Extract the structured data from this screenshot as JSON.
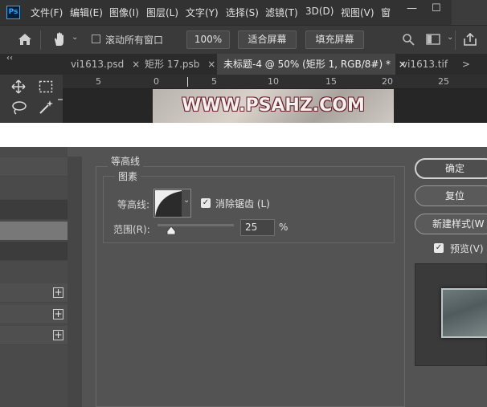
{
  "app": {
    "logo_text": "Ps"
  },
  "menubar": {
    "items": [
      "文件(F)",
      "编辑(E)",
      "图像(I)",
      "图层(L)",
      "文字(Y)",
      "选择(S)",
      "滤镜(T)",
      "3D(D)",
      "视图(V)",
      "窗"
    ],
    "minimize": "—",
    "maximize": "☐"
  },
  "options_bar": {
    "scroll_all_label": "滚动所有窗口",
    "zoom_value": "100%",
    "fit_screen_label": "适合屏幕",
    "fill_screen_label": "填充屏幕"
  },
  "tabs": [
    {
      "label": "vi1613.psd",
      "close": "×"
    },
    {
      "label": "矩形 17.psb",
      "close": "×"
    },
    {
      "label": "未标题-4 @ 50% (矩形 1, RGB/8#) *",
      "close": "×"
    },
    {
      "label": "vi1613.tif",
      "close": ">"
    }
  ],
  "collapse_glyph": "‹‹",
  "ruler": {
    "ticks": [
      "5",
      "0",
      "5",
      "10",
      "15",
      "20",
      "25"
    ]
  },
  "canvas": {
    "watermark_text": "WWW.PSAHZ.COM"
  },
  "dialog": {
    "contour_section_title": "等高线",
    "elements_group_title": "图素",
    "contour_label": "等高线:",
    "anti_alias_label": "消除锯齿 (L)",
    "range_label": "范围(R):",
    "range_value": "25",
    "range_unit": "%",
    "range_percent": 25,
    "ok_label": "确定",
    "reset_label": "复位",
    "new_style_label": "新建样式(W",
    "preview_label": "预览(V)",
    "left_list_plus": [
      "+",
      "+",
      "+"
    ]
  },
  "colors": {
    "accent": "#31a8ff",
    "background": "#535353"
  }
}
